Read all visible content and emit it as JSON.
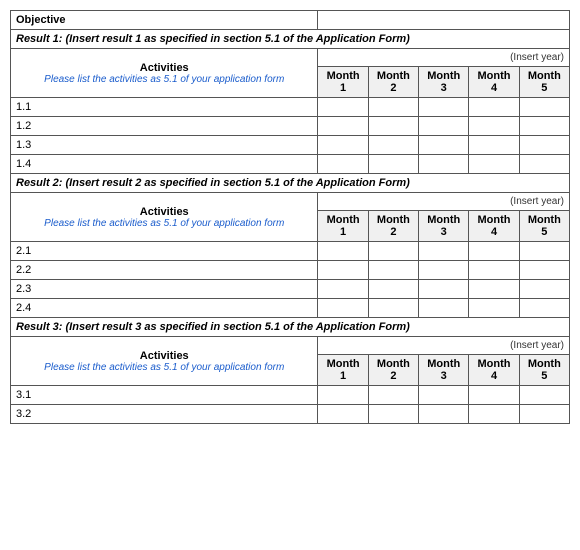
{
  "table": {
    "objective_label": "Objective",
    "insert_year": "(Insert year)",
    "activities_label": "Activities",
    "activities_note": "Please list the activities as 5.1 of your application form",
    "months": [
      {
        "label": "Month",
        "num": "1"
      },
      {
        "label": "Month",
        "num": "2"
      },
      {
        "label": "Month",
        "num": "3"
      },
      {
        "label": "Month",
        "num": "4"
      },
      {
        "label": "Month",
        "num": "5"
      }
    ],
    "results": [
      {
        "header": "Result 1: (Insert result 1 as  specified in section 5.1 of the Application Form)",
        "rows": [
          "1.1",
          "1.2",
          "1.3",
          "1.4"
        ]
      },
      {
        "header": "Result 2: (Insert result 2 as specified in section 5.1 of the Application Form)",
        "rows": [
          "2.1",
          "2.2",
          "2.3",
          "2.4"
        ]
      },
      {
        "header": "Result 3: (Insert result 3 as specified in section 5.1 of the Application Form)",
        "rows": [
          "3.1",
          "3.2"
        ]
      }
    ]
  }
}
